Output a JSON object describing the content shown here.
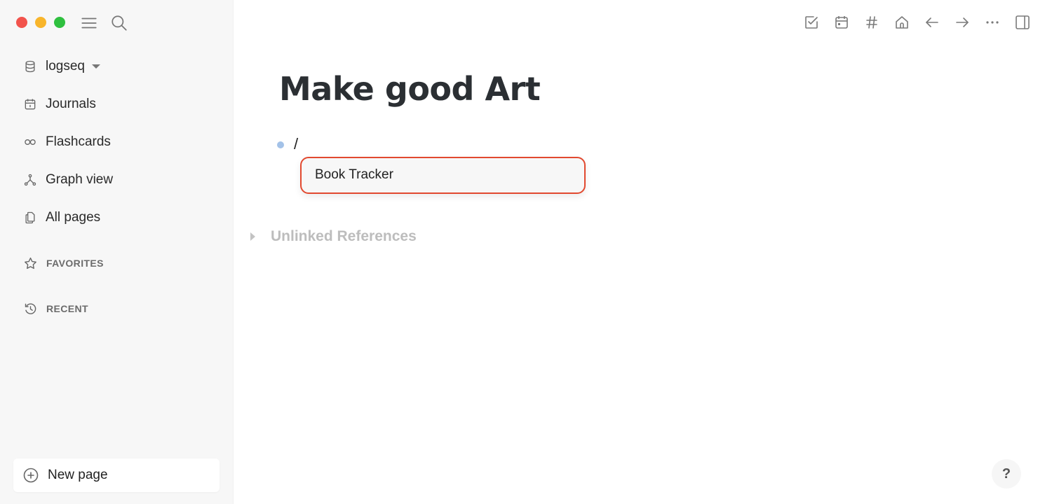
{
  "window": {
    "traffic_lights": [
      "close",
      "minimize",
      "maximize"
    ]
  },
  "sidebar": {
    "top_icons": [
      "menu-icon",
      "search-icon"
    ],
    "graph": {
      "label": "logseq",
      "icon": "database-icon"
    },
    "nav_items": [
      {
        "label": "Journals",
        "icon": "calendar-icon"
      },
      {
        "label": "Flashcards",
        "icon": "infinity-icon"
      },
      {
        "label": "Graph view",
        "icon": "graph-icon"
      },
      {
        "label": "All pages",
        "icon": "pages-icon"
      }
    ],
    "sections": [
      {
        "label": "FAVORITES",
        "icon": "star-icon"
      },
      {
        "label": "RECENT",
        "icon": "history-icon"
      }
    ],
    "new_page": {
      "label": "New page",
      "icon": "plus-circle-icon"
    }
  },
  "toolbar": {
    "buttons": [
      "todo-icon",
      "calendar-icon",
      "hashtag-icon",
      "home-icon",
      "arrow-left-icon",
      "arrow-right-icon",
      "more-icon",
      "sidebar-toggle-icon"
    ]
  },
  "page": {
    "title": "Make good Art",
    "block_text": "/",
    "autocomplete": {
      "items": [
        "Book Tracker"
      ]
    },
    "unlinked_references_label": "Unlinked References"
  },
  "help": {
    "label": "?"
  },
  "colors": {
    "sidebar_bg": "#f7f7f7",
    "accent_highlight": "#e2492f",
    "bullet": "#a3c2e8",
    "title": "#2b2f33"
  }
}
